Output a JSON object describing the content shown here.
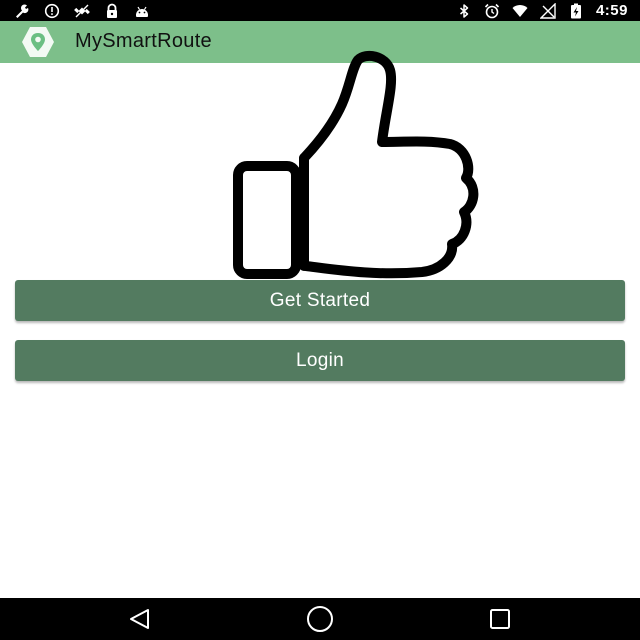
{
  "status_bar": {
    "time": "4:59",
    "left_icons": [
      "wrench-icon",
      "alert-circle-icon",
      "satellite-icon",
      "lock-icon",
      "android-icon"
    ],
    "right_icons": [
      "bluetooth-icon",
      "alarm-clock-icon",
      "wifi-icon",
      "no-signal-icon",
      "battery-charging-icon"
    ]
  },
  "app_bar": {
    "title": "MySmartRoute",
    "logo_icon": "map-pin-hexagon-icon"
  },
  "hero": {
    "illustration_icon": "thumbs-up-icon"
  },
  "buttons": {
    "get_started": "Get Started",
    "login": "Login"
  },
  "nav_bar": {
    "icons": [
      "back-triangle-icon",
      "home-circle-icon",
      "recents-square-icon"
    ]
  },
  "colors": {
    "app_bar_bg": "#7dbf8a",
    "button_bg": "#537b60",
    "button_text": "#ffffff",
    "status_bar_bg": "#000000",
    "nav_bar_bg": "#000000"
  }
}
